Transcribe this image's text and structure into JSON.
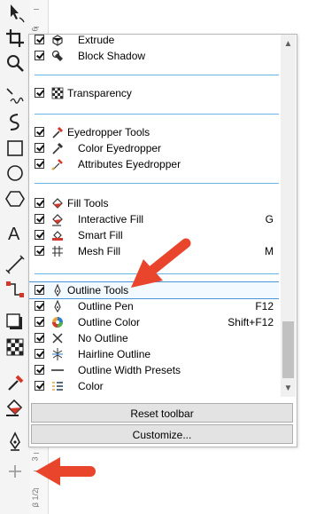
{
  "toolbox": {
    "tools": [
      {
        "name": "pick-tool-icon"
      },
      {
        "name": "crop-tool-icon"
      },
      {
        "name": "zoom-tool-icon"
      },
      {
        "name": "freehand-tool-icon"
      },
      {
        "name": "artistic-media-tool-icon"
      },
      {
        "name": "rectangle-tool-icon"
      },
      {
        "name": "ellipse-tool-icon"
      },
      {
        "name": "polygon-tool-icon"
      },
      {
        "name": "text-tool-icon"
      },
      {
        "name": "parallel-dimension-tool-icon"
      },
      {
        "name": "connector-tool-icon"
      },
      {
        "name": "drop-shadow-tool-icon"
      },
      {
        "name": "transparency-tool-icon"
      },
      {
        "name": "eyedropper-tool-icon"
      },
      {
        "name": "interactive-fill-tool-icon"
      },
      {
        "name": "outline-pen-tool-icon"
      },
      {
        "name": "add-tool-icon"
      }
    ]
  },
  "ruler": {
    "labels": [
      "6",
      "3",
      "3 1/2"
    ]
  },
  "menu": {
    "items": [
      {
        "label": "Extrude",
        "checked": true,
        "icon": "extrude-icon",
        "indent": 1,
        "key": ""
      },
      {
        "label": "Block Shadow",
        "checked": true,
        "icon": "block-shadow-icon",
        "indent": 1,
        "key": ""
      },
      {
        "label": "Transparency",
        "checked": true,
        "icon": "transparency-icon",
        "indent": 0,
        "key": ""
      },
      {
        "label": "Eyedropper Tools",
        "checked": true,
        "icon": "eyedropper-tools-icon",
        "indent": 0,
        "key": ""
      },
      {
        "label": "Color Eyedropper",
        "checked": true,
        "icon": "color-eyedropper-icon",
        "indent": 1,
        "key": ""
      },
      {
        "label": "Attributes Eyedropper",
        "checked": true,
        "icon": "attributes-eyedropper-icon",
        "indent": 1,
        "key": ""
      },
      {
        "label": "Fill Tools",
        "checked": true,
        "icon": "fill-tools-icon",
        "indent": 0,
        "key": ""
      },
      {
        "label": "Interactive Fill",
        "checked": true,
        "icon": "interactive-fill-icon",
        "indent": 1,
        "key": "G"
      },
      {
        "label": "Smart Fill",
        "checked": true,
        "icon": "smart-fill-icon",
        "indent": 1,
        "key": ""
      },
      {
        "label": "Mesh Fill",
        "checked": true,
        "icon": "mesh-fill-icon",
        "indent": 1,
        "key": "M"
      },
      {
        "label": "Outline Tools",
        "checked": true,
        "icon": "outline-tools-icon",
        "indent": 0,
        "key": "",
        "selected": true
      },
      {
        "label": "Outline Pen",
        "checked": true,
        "icon": "outline-pen-icon",
        "indent": 1,
        "key": "F12"
      },
      {
        "label": "Outline Color",
        "checked": true,
        "icon": "outline-color-icon",
        "indent": 1,
        "key": "Shift+F12"
      },
      {
        "label": "No Outline",
        "checked": true,
        "icon": "no-outline-icon",
        "indent": 1,
        "key": ""
      },
      {
        "label": "Hairline Outline",
        "checked": true,
        "icon": "hairline-outline-icon",
        "indent": 1,
        "key": ""
      },
      {
        "label": "Outline Width Presets",
        "checked": true,
        "icon": "outline-width-presets-icon",
        "indent": 1,
        "key": ""
      },
      {
        "label": "Color",
        "checked": true,
        "icon": "color-icon",
        "indent": 1,
        "key": ""
      }
    ],
    "scrollbar": {
      "up": "▲",
      "down": "▼"
    },
    "reset_label": "Reset toolbar",
    "customize_label": "Customize..."
  },
  "colors": {
    "accent": "#4a95d5",
    "separator": "#6fb4e6",
    "arrow": "#e8452c"
  }
}
